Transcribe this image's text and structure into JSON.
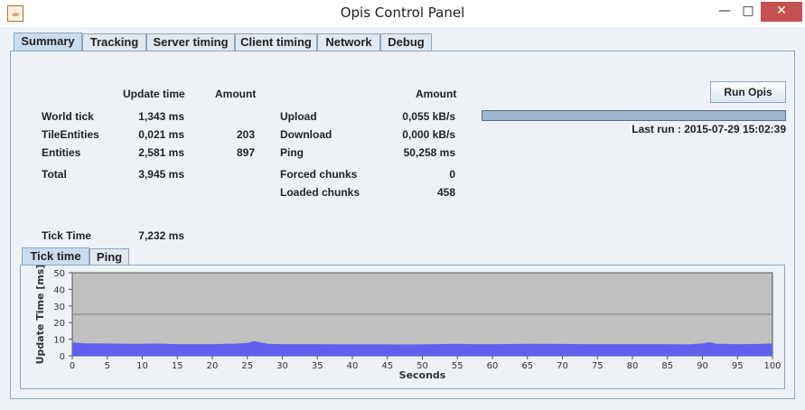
{
  "window": {
    "title": "Opis Control Panel",
    "icon": "java-cup-icon",
    "controls": {
      "minimize": "—",
      "maximize": "□",
      "close": "✕"
    }
  },
  "tabs": [
    {
      "label": "Summary",
      "active": true
    },
    {
      "label": "Tracking"
    },
    {
      "label": "Server timing"
    },
    {
      "label": "Client timing"
    },
    {
      "label": "Network"
    },
    {
      "label": "Debug"
    }
  ],
  "summary": {
    "timing_headers": {
      "update_time": "Update time",
      "amount": "Amount"
    },
    "timing_rows": [
      {
        "name": "World tick",
        "time": "1,343 ms",
        "amount": ""
      },
      {
        "name": "TileEntities",
        "time": "0,021 ms",
        "amount": "203"
      },
      {
        "name": "Entities",
        "time": "2,581 ms",
        "amount": "897"
      }
    ],
    "total": {
      "name": "Total",
      "time": "3,945 ms"
    },
    "network_header": "Amount",
    "network_rows": [
      {
        "name": "Upload",
        "value": "0,055 kB/s"
      },
      {
        "name": "Download",
        "value": "0,000 kB/s"
      },
      {
        "name": "Ping",
        "value": "50,258 ms"
      }
    ],
    "chunk_rows": [
      {
        "name": "Forced chunks",
        "value": "0"
      },
      {
        "name": "Loaded chunks",
        "value": "458"
      }
    ],
    "run_button": "Run Opis",
    "progress": 1.0,
    "last_run": "Last run : 2015-07-29 15:02:39",
    "tick_time": {
      "label": "Tick Time",
      "value": "7,232 ms"
    }
  },
  "subtabs": [
    {
      "label": "Tick time",
      "active": true
    },
    {
      "label": "Ping"
    }
  ],
  "chart_data": {
    "type": "area",
    "xlabel": "Seconds",
    "ylabel": "Update Time [ms]",
    "xlim": [
      0,
      100
    ],
    "ylim": [
      0,
      50
    ],
    "x_ticks": [
      0,
      5,
      10,
      15,
      20,
      25,
      30,
      35,
      40,
      45,
      50,
      55,
      60,
      65,
      70,
      75,
      80,
      85,
      90,
      95,
      100
    ],
    "y_ticks": [
      0,
      10,
      20,
      30,
      40,
      50
    ],
    "reference_line": 25,
    "grid": false,
    "colors": {
      "area": "#6060ee",
      "background": "#c0c0c0",
      "reference_line": "#808080"
    },
    "x": [
      0,
      2,
      5,
      8,
      10,
      12,
      15,
      18,
      20,
      23,
      25,
      26,
      28,
      30,
      35,
      40,
      45,
      48,
      50,
      55,
      58,
      60,
      65,
      70,
      75,
      80,
      85,
      88,
      90,
      91,
      92,
      95,
      98,
      100
    ],
    "values": [
      8.0,
      7.5,
      7.4,
      7.2,
      7.2,
      7.4,
      7.0,
      7.0,
      7.0,
      7.3,
      7.8,
      8.8,
      7.2,
      7.0,
      7.0,
      6.9,
      6.9,
      6.8,
      6.9,
      7.2,
      7.0,
      7.0,
      7.2,
      7.1,
      7.0,
      7.0,
      7.0,
      6.9,
      7.5,
      8.2,
      7.3,
      7.0,
      7.1,
      7.4
    ]
  }
}
